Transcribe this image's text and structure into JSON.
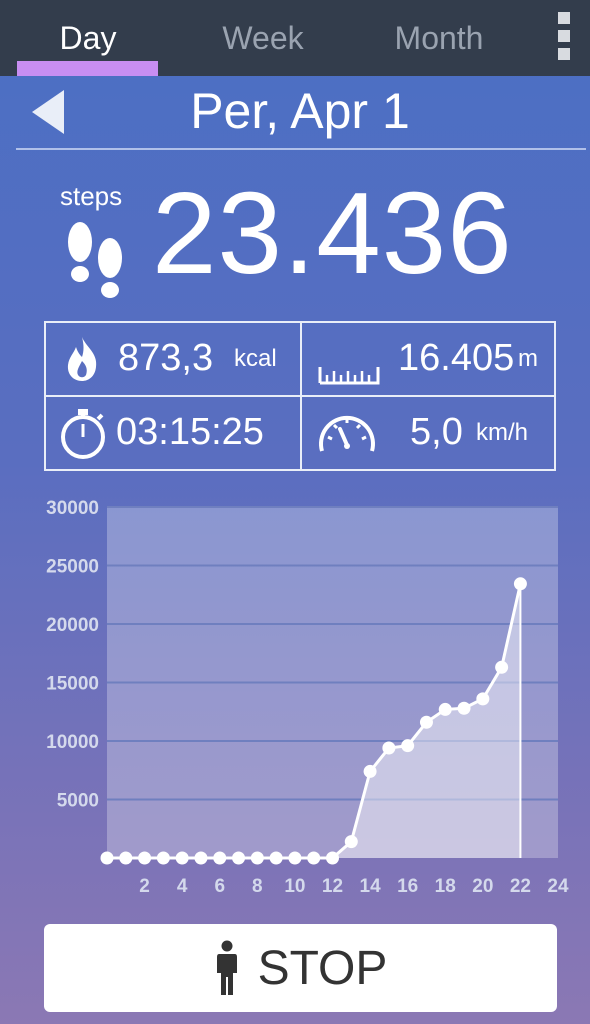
{
  "tabs": [
    {
      "label": "Day",
      "active": true
    },
    {
      "label": "Week",
      "active": false
    },
    {
      "label": "Month",
      "active": false
    }
  ],
  "header": {
    "date": "Per, Apr 1"
  },
  "steps": {
    "label": "steps",
    "value": "23.436"
  },
  "stats": {
    "calories": {
      "value": "873,3",
      "unit": "kcal",
      "icon": "flame-icon"
    },
    "distance": {
      "value": "16.405",
      "unit": "m",
      "icon": "ruler-icon"
    },
    "duration": {
      "value": "03:15:25",
      "unit": "",
      "icon": "stopwatch-icon"
    },
    "speed": {
      "value": "5,0",
      "unit": "km/h",
      "icon": "speedometer-icon"
    }
  },
  "chart_data": {
    "type": "line",
    "title": "",
    "xlabel": "",
    "ylabel": "",
    "ylim": [
      0,
      30000
    ],
    "xlim": [
      0,
      24
    ],
    "yticks": [
      "30000",
      "25000",
      "20000",
      "15000",
      "10000",
      "5000"
    ],
    "xticks": [
      "2",
      "4",
      "6",
      "8",
      "10",
      "12",
      "14",
      "16",
      "18",
      "20",
      "22",
      "24"
    ],
    "x": [
      0,
      1,
      2,
      3,
      4,
      5,
      6,
      7,
      8,
      9,
      10,
      11,
      12,
      13,
      14,
      15,
      16,
      17,
      18,
      19,
      20,
      21,
      22
    ],
    "series": [
      {
        "values": [
          0,
          0,
          0,
          0,
          0,
          0,
          0,
          0,
          0,
          0,
          0,
          0,
          0,
          1400,
          7400,
          9400,
          9600,
          11600,
          12700,
          12800,
          13600,
          16300,
          23436
        ]
      }
    ],
    "grid": true,
    "colors": {
      "line": "#ffffff",
      "fill": "rgba(255,255,255,0.45)",
      "plot_bg": "rgba(255,255,255,0.28)",
      "grid": "#6f7fbf"
    }
  },
  "stop_button": {
    "label": "STOP",
    "icon": "person-icon"
  },
  "colors": {
    "accent": "#c88ef2",
    "topbar": "#333d4c"
  }
}
